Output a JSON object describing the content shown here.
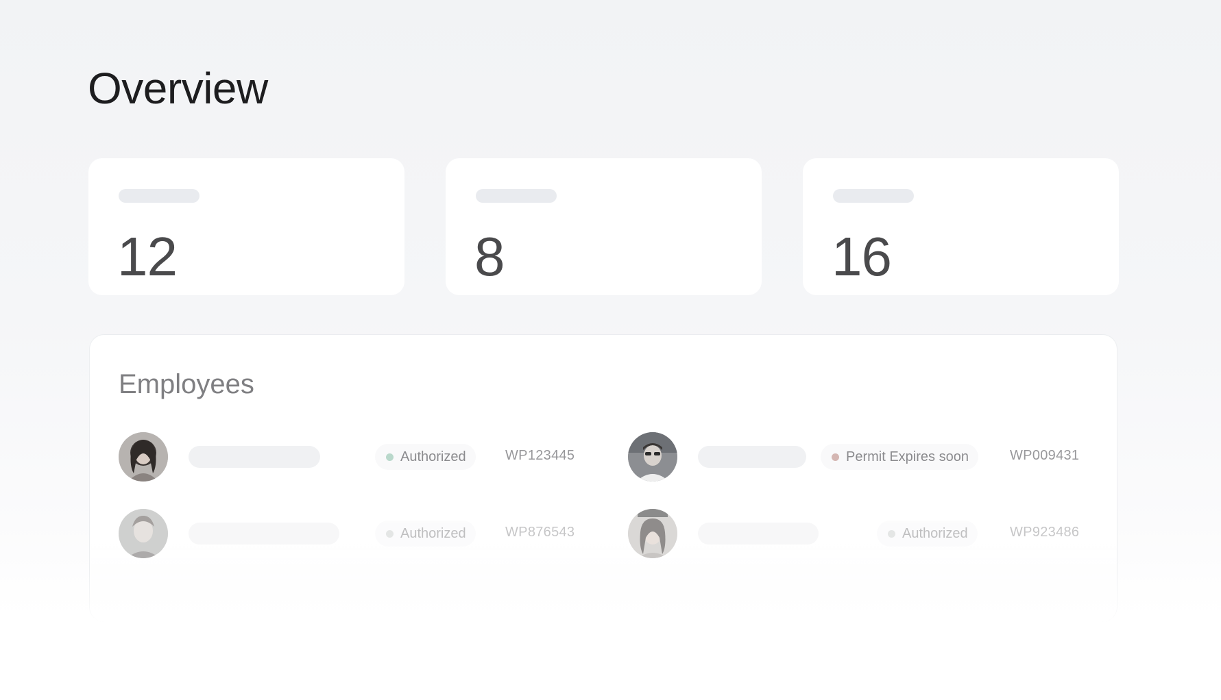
{
  "page": {
    "title": "Overview"
  },
  "stats": [
    {
      "value": "12"
    },
    {
      "value": "8"
    },
    {
      "value": "16"
    }
  ],
  "employees": {
    "title": "Employees",
    "rows": [
      {
        "status": "Authorized",
        "status_color": "#b9d8cb",
        "permit": "WP123445"
      },
      {
        "status": "Permit Expires soon",
        "status_color": "#d4b6b2",
        "permit": "WP009431"
      },
      {
        "status": "Authorized",
        "status_color": "#cfd3d1",
        "permit": "WP876543"
      },
      {
        "status": "Authorized",
        "status_color": "#cfd3d1",
        "permit": "WP923486"
      }
    ]
  },
  "colors": {
    "background": "#f3f4f6",
    "card": "#ffffff",
    "skeleton": "#e9ebef",
    "title_text": "#1d1d1f",
    "stat_text": "#4a4a4c",
    "muted_text": "#7f7f82"
  }
}
